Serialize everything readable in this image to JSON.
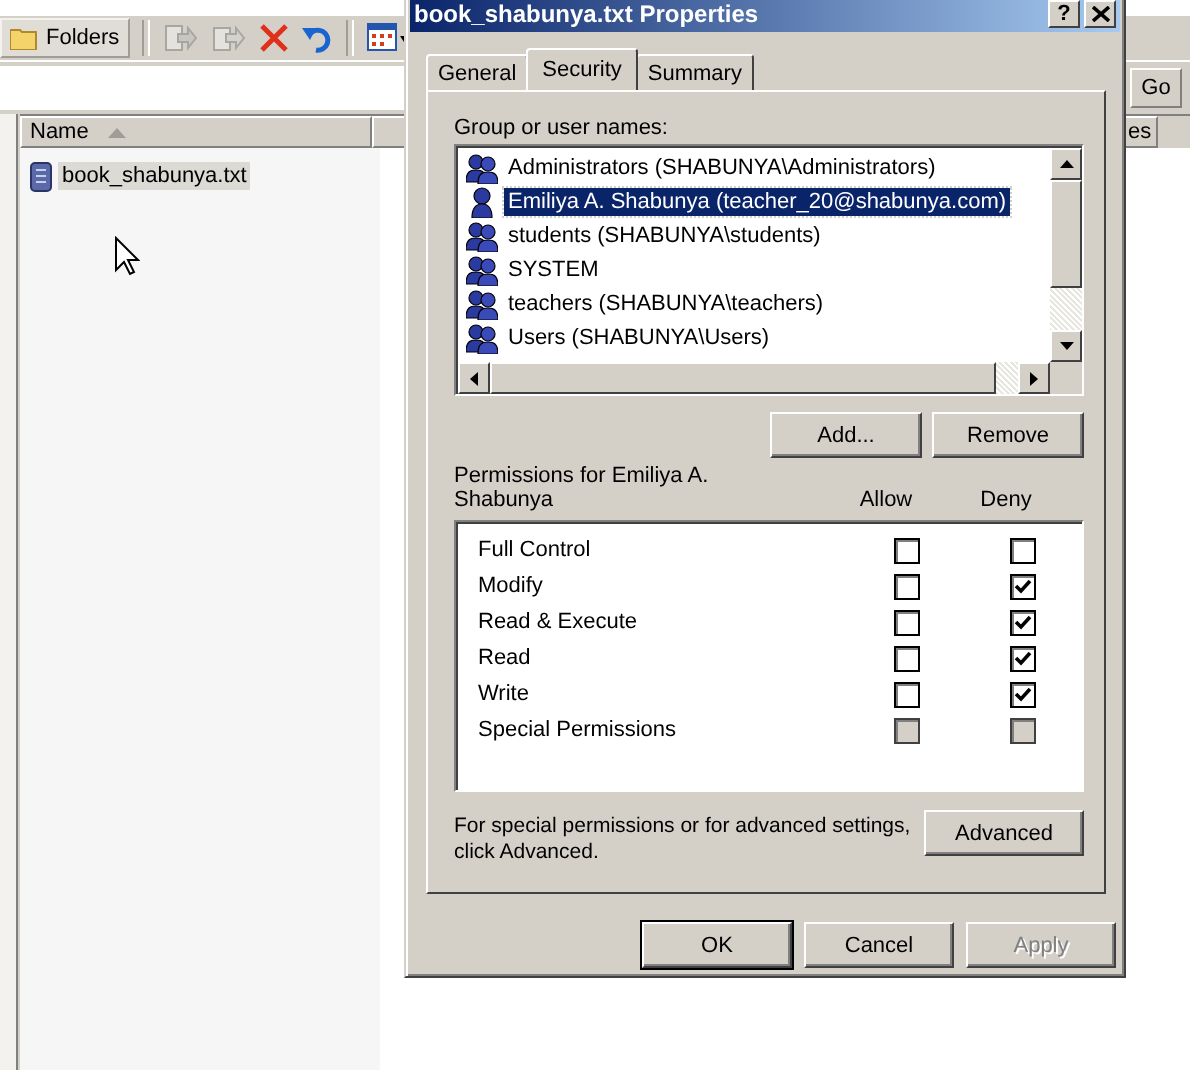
{
  "explorer": {
    "folders_button": "Folders",
    "go_button": "Go",
    "name_header": "Name",
    "column_2_header": "es",
    "files": [
      {
        "name": "book_shabunya.txt",
        "selected": true
      }
    ]
  },
  "dialog": {
    "title": "book_shabunya.txt Properties",
    "help_button": "?",
    "tabs": [
      {
        "label": "General",
        "selected": false
      },
      {
        "label": "Security",
        "selected": true
      },
      {
        "label": "Summary",
        "selected": false
      }
    ],
    "group_label": "Group or user names:",
    "principals": [
      {
        "name": "Administrators (SHABUNYA\\Administrators)",
        "kind": "group",
        "selected": false
      },
      {
        "name": "Emiliya A. Shabunya (teacher_20@shabunya.com)",
        "kind": "user",
        "selected": true
      },
      {
        "name": "students (SHABUNYA\\students)",
        "kind": "group",
        "selected": false
      },
      {
        "name": "SYSTEM",
        "kind": "group",
        "selected": false
      },
      {
        "name": "teachers (SHABUNYA\\teachers)",
        "kind": "group",
        "selected": false
      },
      {
        "name": "Users (SHABUNYA\\Users)",
        "kind": "group",
        "selected": false
      }
    ],
    "add_button": "Add...",
    "remove_button": "Remove",
    "permissions_label": "Permissions for Emiliya A. Shabunya",
    "allow_header": "Allow",
    "deny_header": "Deny",
    "permissions": [
      {
        "name": "Full Control",
        "allow": {
          "checked": false,
          "disabled": false
        },
        "deny": {
          "checked": false,
          "disabled": false
        }
      },
      {
        "name": "Modify",
        "allow": {
          "checked": false,
          "disabled": false
        },
        "deny": {
          "checked": true,
          "disabled": false
        }
      },
      {
        "name": "Read & Execute",
        "allow": {
          "checked": false,
          "disabled": false
        },
        "deny": {
          "checked": true,
          "disabled": false
        }
      },
      {
        "name": "Read",
        "allow": {
          "checked": false,
          "disabled": false
        },
        "deny": {
          "checked": true,
          "disabled": false
        }
      },
      {
        "name": "Write",
        "allow": {
          "checked": false,
          "disabled": false
        },
        "deny": {
          "checked": true,
          "disabled": false
        }
      },
      {
        "name": "Special Permissions",
        "allow": {
          "checked": false,
          "disabled": true
        },
        "deny": {
          "checked": false,
          "disabled": true
        }
      }
    ],
    "advanced_note": "For special permissions or for advanced settings, click Advanced.",
    "advanced_button": "Advanced",
    "footer_buttons": [
      {
        "label": "OK",
        "kind": "default",
        "disabled": false
      },
      {
        "label": "Cancel",
        "kind": "normal",
        "disabled": false
      },
      {
        "label": "Apply",
        "kind": "normal",
        "disabled": true
      }
    ]
  }
}
